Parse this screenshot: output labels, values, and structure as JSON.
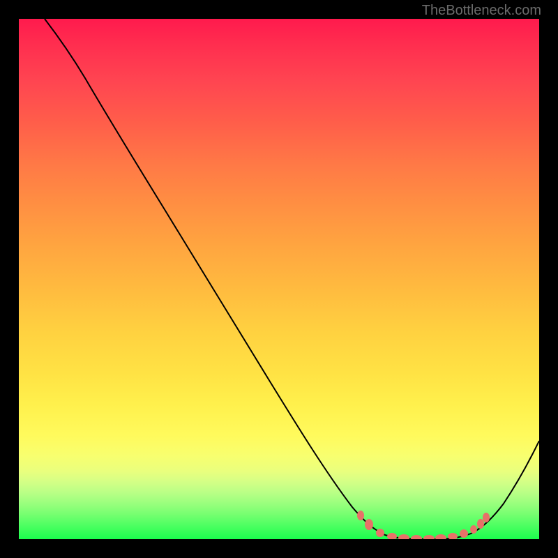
{
  "watermark": "TheBottleneck.com",
  "chart_data": {
    "type": "line",
    "title": "",
    "xlabel": "",
    "ylabel": "",
    "xlim": [
      0,
      100
    ],
    "ylim": [
      0,
      100
    ],
    "curve": {
      "description": "V-shaped bottleneck curve descending from top-left to minimum around x=75-85, then rising",
      "points": [
        {
          "x": 5,
          "y": 100
        },
        {
          "x": 10,
          "y": 95
        },
        {
          "x": 15,
          "y": 88
        },
        {
          "x": 20,
          "y": 80
        },
        {
          "x": 25,
          "y": 72
        },
        {
          "x": 30,
          "y": 64
        },
        {
          "x": 35,
          "y": 56
        },
        {
          "x": 40,
          "y": 48
        },
        {
          "x": 45,
          "y": 40
        },
        {
          "x": 50,
          "y": 32
        },
        {
          "x": 55,
          "y": 24
        },
        {
          "x": 60,
          "y": 16
        },
        {
          "x": 65,
          "y": 9
        },
        {
          "x": 70,
          "y": 4
        },
        {
          "x": 75,
          "y": 1
        },
        {
          "x": 80,
          "y": 0
        },
        {
          "x": 85,
          "y": 1
        },
        {
          "x": 90,
          "y": 5
        },
        {
          "x": 95,
          "y": 12
        },
        {
          "x": 100,
          "y": 20
        }
      ]
    },
    "highlighted_points": [
      {
        "x": 66,
        "y": 7
      },
      {
        "x": 68,
        "y": 5
      },
      {
        "x": 70,
        "y": 3
      },
      {
        "x": 73,
        "y": 1.5
      },
      {
        "x": 75,
        "y": 1
      },
      {
        "x": 77,
        "y": 0.5
      },
      {
        "x": 79,
        "y": 0.5
      },
      {
        "x": 81,
        "y": 0.5
      },
      {
        "x": 83,
        "y": 0.5
      },
      {
        "x": 85,
        "y": 1
      },
      {
        "x": 87,
        "y": 2
      },
      {
        "x": 88,
        "y": 3
      },
      {
        "x": 89,
        "y": 4
      }
    ]
  }
}
